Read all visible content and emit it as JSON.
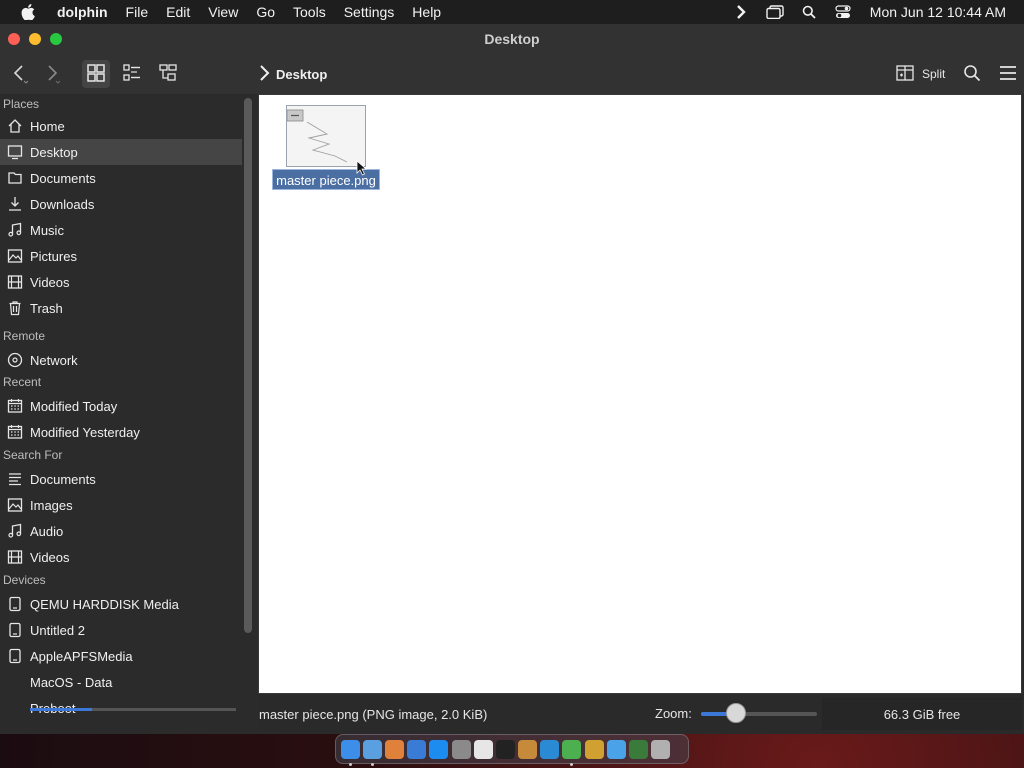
{
  "menubar": {
    "app_name": "dolphin",
    "items": [
      "File",
      "Edit",
      "View",
      "Go",
      "Tools",
      "Settings",
      "Help"
    ],
    "clock": "Mon Jun 12  10:44 AM"
  },
  "window": {
    "title": "Desktop"
  },
  "toolbar": {
    "breadcrumb": "Desktop",
    "split_label": "Split"
  },
  "sidebar": {
    "sections": {
      "places": "Places",
      "remote": "Remote",
      "recent": "Recent",
      "search_for": "Search For",
      "devices": "Devices"
    },
    "places": [
      {
        "label": "Home",
        "icon": "home-icon"
      },
      {
        "label": "Desktop",
        "icon": "desktop-icon",
        "selected": true
      },
      {
        "label": "Documents",
        "icon": "documents-icon"
      },
      {
        "label": "Downloads",
        "icon": "downloads-icon"
      },
      {
        "label": "Music",
        "icon": "music-icon"
      },
      {
        "label": "Pictures",
        "icon": "pictures-icon"
      },
      {
        "label": "Videos",
        "icon": "videos-icon"
      },
      {
        "label": "Trash",
        "icon": "trash-icon"
      }
    ],
    "remote": [
      {
        "label": "Network",
        "icon": "network-icon"
      }
    ],
    "recent": [
      {
        "label": "Modified Today",
        "icon": "calendar-icon"
      },
      {
        "label": "Modified Yesterday",
        "icon": "calendar-icon"
      }
    ],
    "search_for": [
      {
        "label": "Documents",
        "icon": "documents-icon"
      },
      {
        "label": "Images",
        "icon": "pictures-icon"
      },
      {
        "label": "Audio",
        "icon": "music-icon"
      },
      {
        "label": "Videos",
        "icon": "videos-icon"
      }
    ],
    "devices": [
      {
        "label": "QEMU HARDDISK Media",
        "icon": "drive-icon"
      },
      {
        "label": "Untitled 2",
        "icon": "drive-icon"
      },
      {
        "label": "AppleAPFSMedia",
        "icon": "drive-icon"
      },
      {
        "label": "MacOS - Data",
        "icon": ""
      },
      {
        "label": "Preboot",
        "icon": ""
      }
    ]
  },
  "files": [
    {
      "name": "master piece.png",
      "selected": true
    }
  ],
  "status": {
    "text": "master piece.png (PNG image, 2.0 KiB)",
    "zoom_label": "Zoom:",
    "zoom_level": 0.3,
    "free_space": "66.3 GiB free"
  },
  "dock": {
    "apps": [
      {
        "icon": "finder-icon",
        "color": "#3d8ee8",
        "running": true
      },
      {
        "icon": "files-icon",
        "color": "#5aa0e0",
        "running": true
      },
      {
        "icon": "launchpad-icon",
        "color": "#e0813b",
        "running": false
      },
      {
        "icon": "safari-icon",
        "color": "#3a7bd5",
        "running": false
      },
      {
        "icon": "app-store-icon",
        "color": "#1d8cf0",
        "running": false
      },
      {
        "icon": "settings-icon",
        "color": "#8a8a8a",
        "running": false
      },
      {
        "icon": "text-editor-icon",
        "color": "#e6e6e6",
        "running": false
      },
      {
        "icon": "terminal-icon",
        "color": "#222222",
        "running": false
      },
      {
        "icon": "brush-icon",
        "color": "#c58a3a",
        "running": false
      },
      {
        "icon": "vscode-icon",
        "color": "#2a8ad4",
        "running": false
      },
      {
        "icon": "chrome-icon",
        "color": "#4caf50",
        "running": true
      },
      {
        "icon": "tools-icon",
        "color": "#d0a030",
        "running": false
      },
      {
        "icon": "folder-icon",
        "color": "#4aa3e8",
        "running": false
      },
      {
        "icon": "monitor-icon",
        "color": "#3a7a3a",
        "running": false
      },
      {
        "icon": "trash-icon",
        "color": "#b0b0b0",
        "running": false
      }
    ]
  }
}
